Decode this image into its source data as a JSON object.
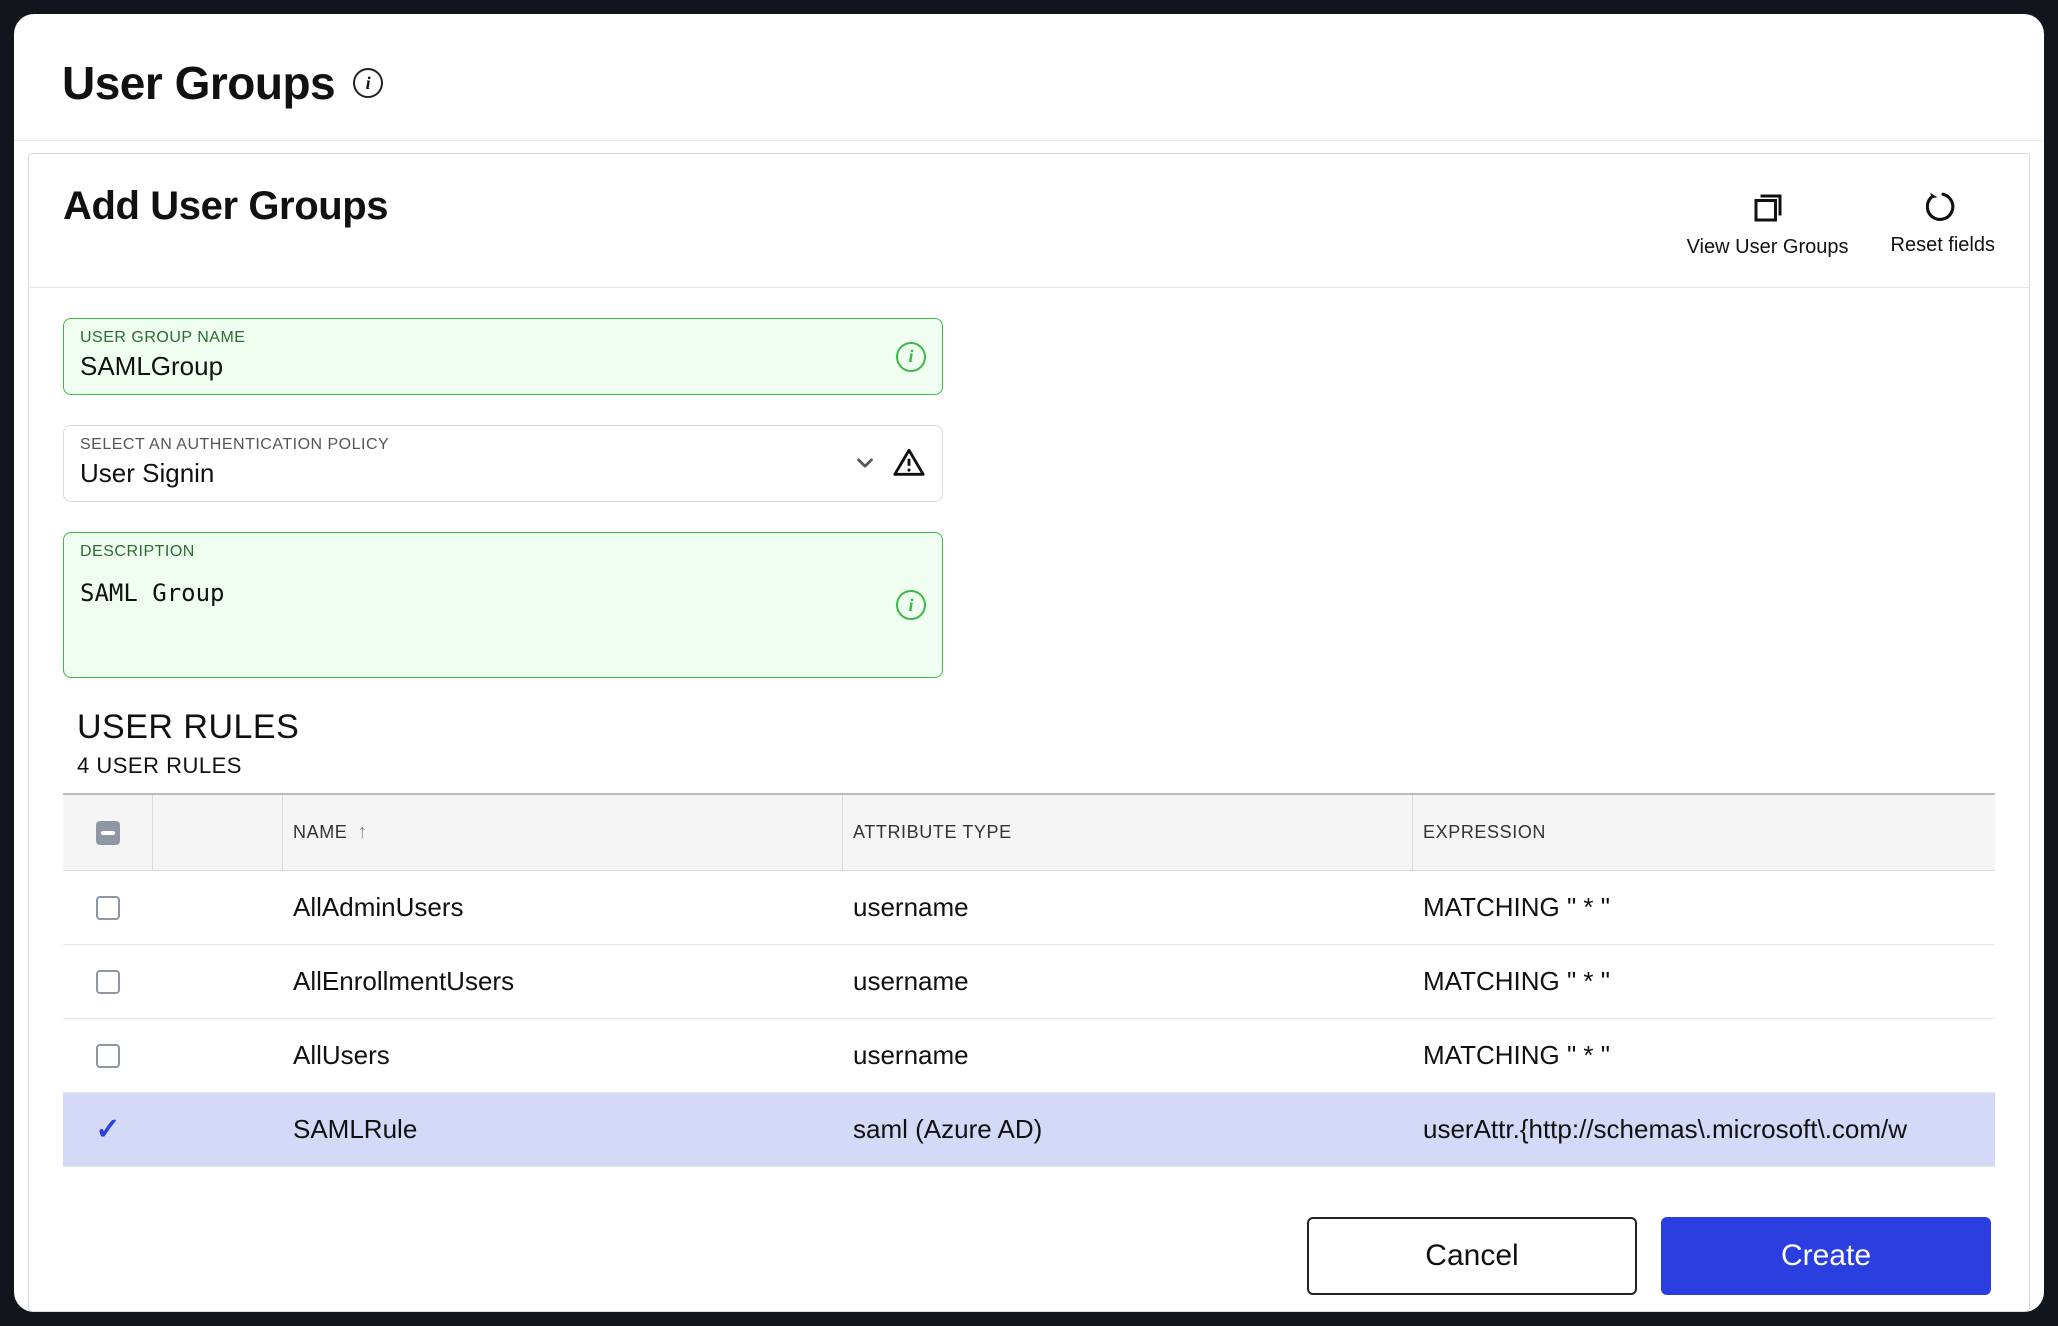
{
  "page": {
    "title": "User Groups"
  },
  "panel": {
    "title": "Add User Groups",
    "actions": {
      "view_groups": "View User Groups",
      "reset_fields": "Reset fields"
    }
  },
  "form": {
    "group_name": {
      "label": "USER GROUP NAME",
      "value": "SAMLGroup"
    },
    "auth_policy": {
      "label": "SELECT AN AUTHENTICATION POLICY",
      "value": "User Signin"
    },
    "description": {
      "label": "DESCRIPTION",
      "value": "SAML Group"
    }
  },
  "rules": {
    "heading": "USER RULES",
    "count_label": "4 USER RULES",
    "columns": {
      "name": "NAME",
      "attribute_type": "ATTRIBUTE TYPE",
      "expression": "EXPRESSION"
    },
    "rows": [
      {
        "selected": false,
        "name": "AllAdminUsers",
        "attribute_type": "username",
        "expression": "MATCHING \" * \""
      },
      {
        "selected": false,
        "name": "AllEnrollmentUsers",
        "attribute_type": "username",
        "expression": "MATCHING \" * \""
      },
      {
        "selected": false,
        "name": "AllUsers",
        "attribute_type": "username",
        "expression": "MATCHING \" * \""
      },
      {
        "selected": true,
        "name": "SAMLRule",
        "attribute_type": "saml (Azure AD)",
        "expression": "userAttr.{http://schemas\\.microsoft\\.com/w"
      }
    ]
  },
  "footer": {
    "cancel": "Cancel",
    "create": "Create"
  }
}
